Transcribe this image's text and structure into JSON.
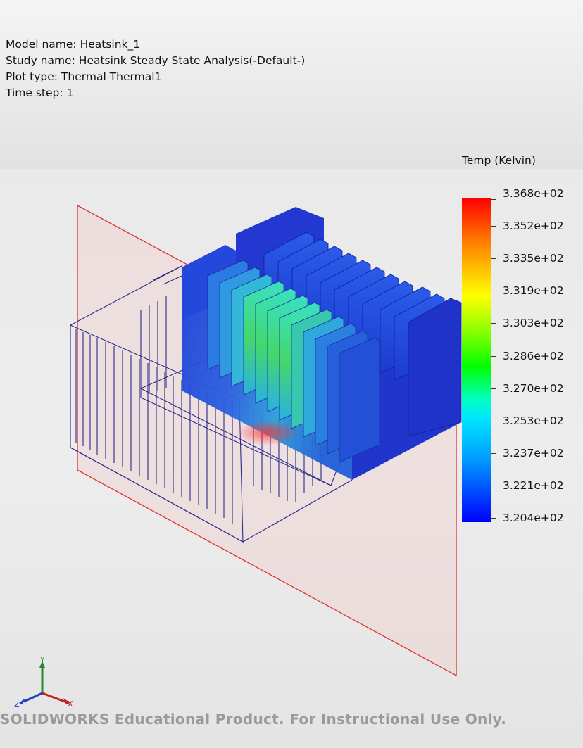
{
  "info": {
    "model_name": "Model name: Heatsink_1",
    "study_name": "Study name: Heatsink Steady State Analysis(-Default-)",
    "plot_type": "Plot type: Thermal Thermal1",
    "time_step": "Time step: 1"
  },
  "legend": {
    "title": "Temp (Kelvin)",
    "ticks": [
      "3.368e+02",
      "3.352e+02",
      "3.335e+02",
      "3.319e+02",
      "3.303e+02",
      "3.286e+02",
      "3.270e+02",
      "3.253e+02",
      "3.237e+02",
      "3.221e+02",
      "3.204e+02"
    ],
    "colors": [
      "#ff0000",
      "#ffff00",
      "#00ff00",
      "#00ffff",
      "#0000ff"
    ]
  },
  "triad": {
    "x": "X",
    "y": "Y",
    "z": "Z"
  },
  "watermark": "SOLIDWORKS Educational Product. For Instructional Use Only."
}
